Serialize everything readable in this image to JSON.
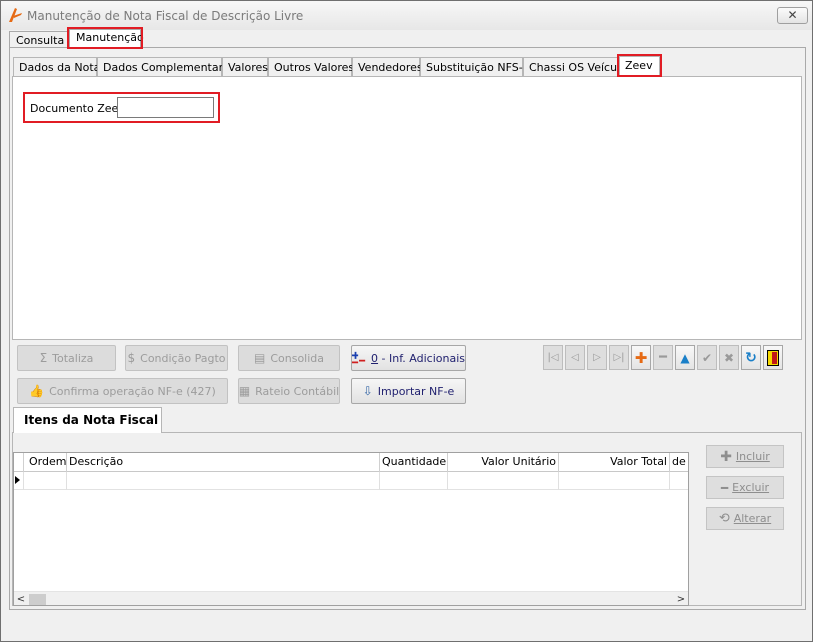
{
  "window": {
    "title": "Manutenção de Nota Fiscal de Descrição Livre",
    "close_glyph": "✕"
  },
  "main_tabs": [
    {
      "label": "Consulta"
    },
    {
      "label": "Manutenção"
    }
  ],
  "sub_tabs": [
    {
      "label": "Dados da Nota"
    },
    {
      "label": "Dados Complementares"
    },
    {
      "label": "Valores"
    },
    {
      "label": "Outros Valores"
    },
    {
      "label": "Vendedores"
    },
    {
      "label": "Substituição NFS-e"
    },
    {
      "label": "Chassi OS Veículo"
    },
    {
      "label": "Zeev"
    }
  ],
  "zeev": {
    "label": "Documento Zeev",
    "value": ""
  },
  "actions": {
    "totaliza": "Totaliza",
    "condicao_pagto": "Condição Pagto",
    "consolida": "Consolida",
    "inf_adicionais_prefix": "0",
    "inf_adicionais": " - Inf. Adicionais",
    "confirma": "Confirma operação NF-e (427)",
    "rateio": "Rateio Contábil",
    "importar": "Importar NF-e"
  },
  "items": {
    "tab_label": "Itens da Nota Fiscal",
    "columns": [
      "Ordem",
      "Descrição",
      "Quantidade",
      "Valor Unitário",
      "Valor Total",
      "de"
    ],
    "incluir": "Incluir",
    "excluir": "Excluir",
    "alterar": "Alterar"
  },
  "colors": {
    "highlight": "#e11c24",
    "accent_orange": "#e66a14",
    "nav_blue": "#1a7fc8"
  },
  "icons": [
    "app-logo-icon",
    "sigma-icon",
    "dollar-icon",
    "consolidate-icon",
    "info-add-icon",
    "thumbs-up-icon",
    "document-icon",
    "import-icon",
    "first-icon",
    "prior-icon",
    "next-icon",
    "last-icon",
    "insert-icon",
    "delete-icon",
    "edit-icon",
    "post-icon",
    "cancel-icon",
    "refresh-icon",
    "exit-icon"
  ]
}
